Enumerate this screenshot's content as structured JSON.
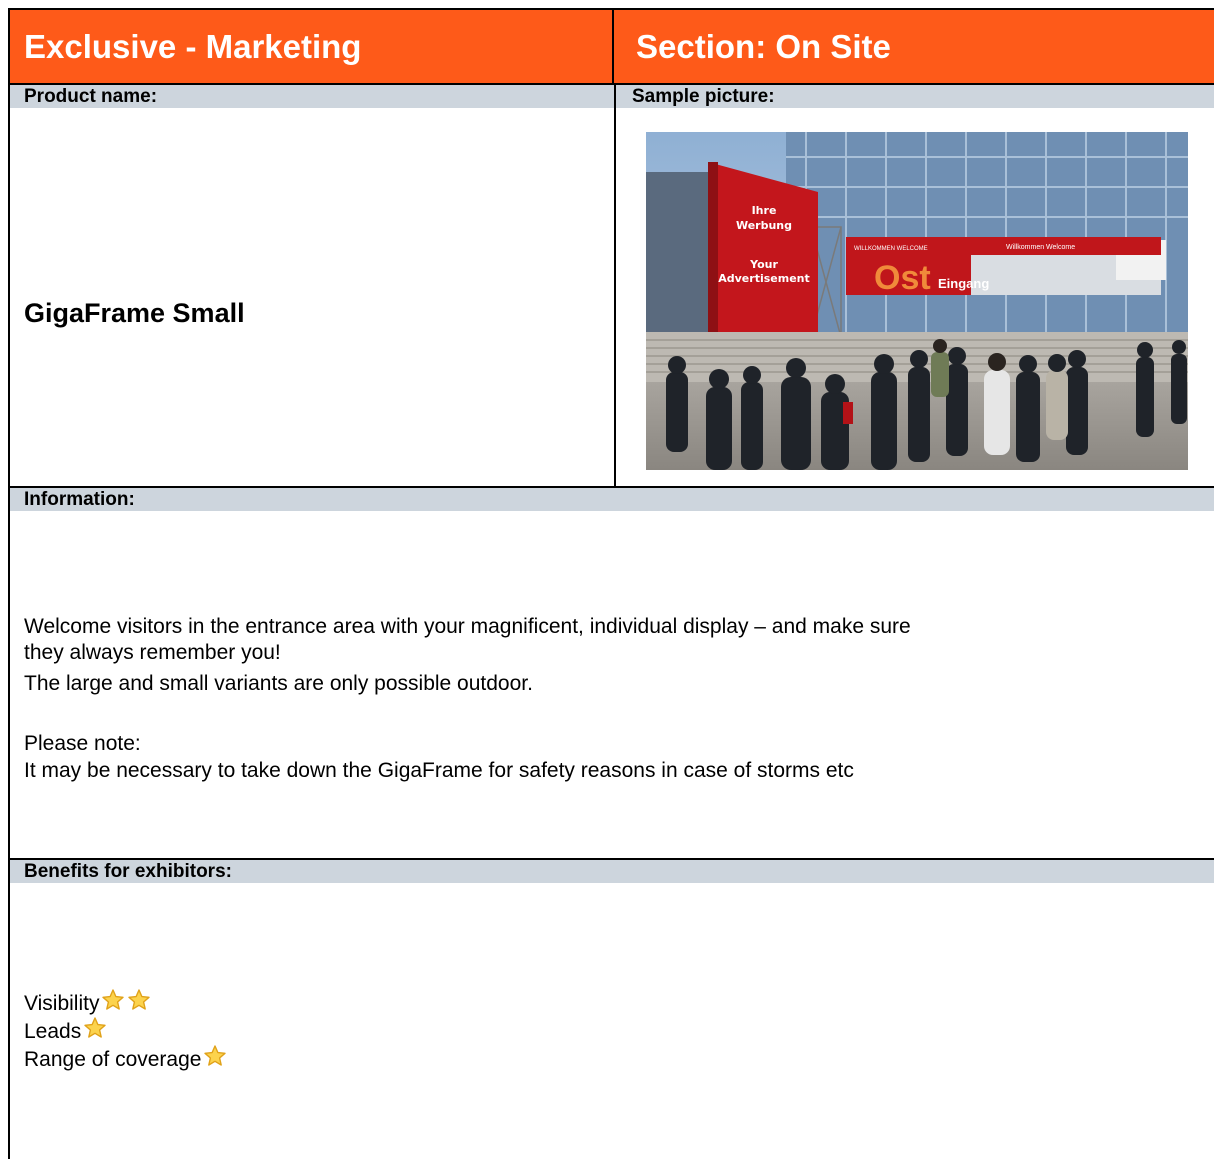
{
  "header": {
    "left_title": "Exclusive - Marketing",
    "right_title": "Section: On Site"
  },
  "product": {
    "name_label": "Product name:",
    "picture_label": "Sample picture:",
    "name": "GigaFrame Small"
  },
  "photo": {
    "banner_lines": [
      "Ihre",
      "Werbung",
      "Your",
      "Advertisement"
    ],
    "sign_text": "Ost",
    "sign_sub": "Eingang",
    "welcome_left": "WILLKOMMEN WELCOME",
    "welcome_right": "Willkommen Welcome"
  },
  "information": {
    "label": "Information:",
    "line1": "Welcome visitors in the entrance area with your magnificent, individual display – and make sure",
    "line2": "they always remember you!",
    "line3": "The large and small variants are only possible outdoor.",
    "line4": "Please note:",
    "line5": "It may be necessary to take down the GigaFrame for safety reasons in case of storms etc"
  },
  "benefits": {
    "label": "Benefits for exhibitors:",
    "items": [
      {
        "label": "Visibility",
        "stars": 2
      },
      {
        "label": "Leads ",
        "stars": 1
      },
      {
        "label": "Range of coverage",
        "stars": 1
      }
    ]
  },
  "colors": {
    "header_orange": "#fe5a19",
    "label_bar_gray": "#cdd5dd",
    "star_fill": "#fcd34d",
    "star_stroke": "#e0a21a"
  }
}
